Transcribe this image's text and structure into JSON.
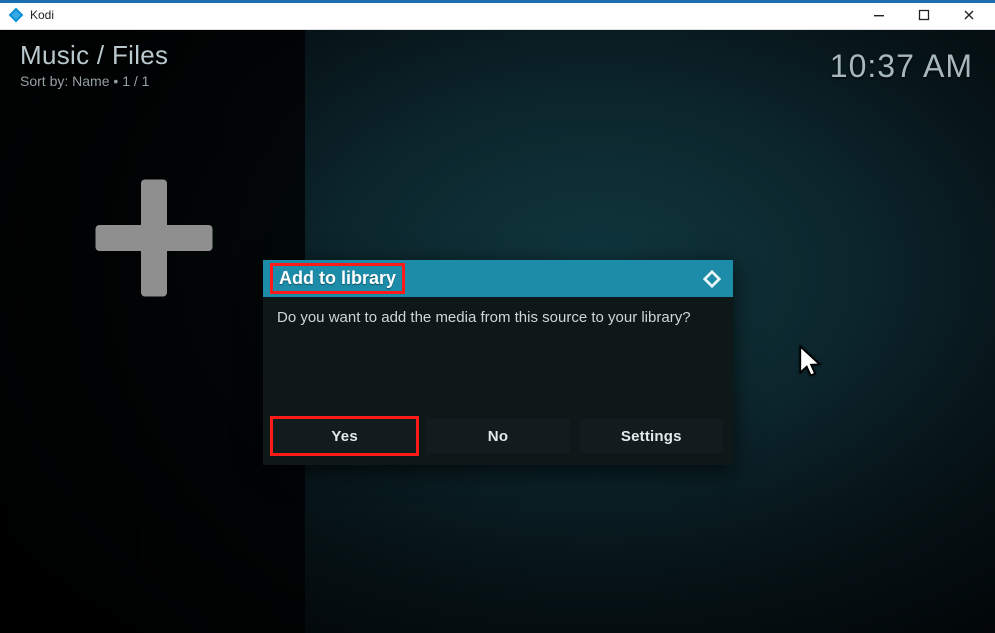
{
  "window": {
    "title": "Kodi"
  },
  "header": {
    "breadcrumb": "Music / Files",
    "sort_prefix": "Sort by: ",
    "sort_value": "Name",
    "page_sep": "  •  ",
    "page": "1 / 1"
  },
  "clock": {
    "time": "10:37 AM"
  },
  "sidebar": {
    "add_tile": "add-source"
  },
  "dialog": {
    "title": "Add to library",
    "message": "Do you want to add the media from this source to your library?",
    "buttons": {
      "yes": "Yes",
      "no": "No",
      "settings": "Settings"
    }
  }
}
